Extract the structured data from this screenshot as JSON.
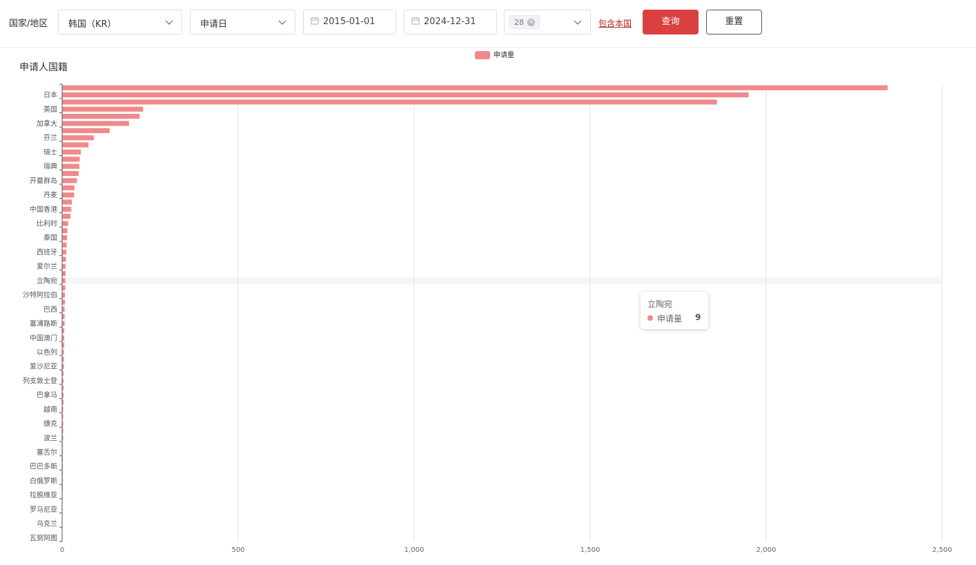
{
  "filters": {
    "country_label": "国家/地区",
    "country_value": "韩国（KR）",
    "date_type_value": "申请日",
    "start_date": "2015-01-01",
    "end_date": "2024-12-31",
    "selected_tag": "28",
    "include_home_link": "包含本国",
    "query_button": "查询",
    "reset_button": "重置"
  },
  "colors": {
    "bar": "#f0898b",
    "primary": "#d9403f",
    "link": "#b3261e"
  },
  "chart_title": "申请人国籍",
  "tooltip": {
    "title": "立陶宛",
    "series": "申请量",
    "value": "9"
  },
  "chart_data": {
    "type": "bar",
    "orientation": "horizontal",
    "series": [
      {
        "name": "申请量"
      }
    ],
    "legend": "top-center",
    "xlim": [
      0,
      2500
    ],
    "x_ticks": [
      "0",
      "500",
      "1,000",
      "1,500",
      "2,000",
      "2,500"
    ],
    "y_tick_labels": [
      "日本",
      "英国",
      "加拿大",
      "芬兰",
      "瑞士",
      "瑞典",
      "开曼群岛",
      "丹麦",
      "中国香港",
      "比利时",
      "泰国",
      "西班牙",
      "爱尔兰",
      "立陶宛",
      "沙特阿拉伯",
      "巴西",
      "塞浦路斯",
      "中国澳门",
      "以色列",
      "爱沙尼亚",
      "列支敦士登",
      "巴拿马",
      "越南",
      "捷克",
      "波兰",
      "塞舌尔",
      "巴巴多斯",
      "白俄罗斯",
      "拉脱维亚",
      "罗马尼亚",
      "乌克兰",
      "瓦努阿图"
    ],
    "bar_count": 64,
    "values": [
      2345,
      1950,
      1860,
      230,
      220,
      190,
      135,
      90,
      75,
      53,
      50,
      49,
      47,
      42,
      35,
      34,
      28,
      26,
      24,
      17,
      15,
      14,
      13,
      12,
      11,
      10,
      10,
      9,
      9,
      8,
      8,
      7,
      7,
      7,
      6,
      6,
      6,
      5,
      5,
      5,
      4,
      4,
      4,
      4,
      4,
      3,
      3,
      3,
      3,
      3,
      2,
      2,
      2,
      2,
      2,
      2,
      2,
      1,
      1,
      1,
      1,
      1,
      1,
      1
    ],
    "highlighted_label": "立陶宛"
  }
}
